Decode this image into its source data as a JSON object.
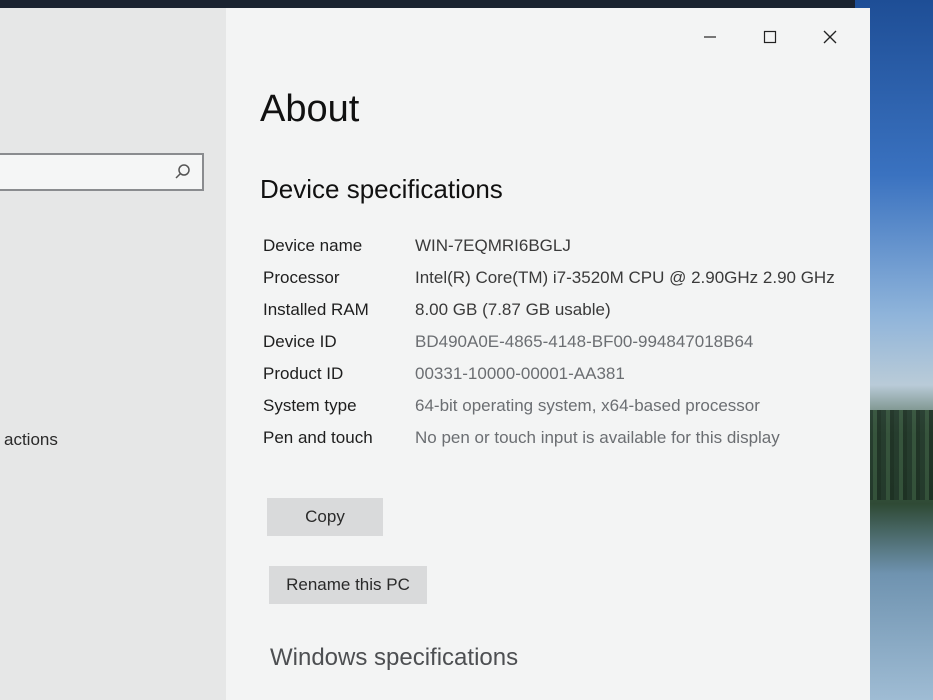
{
  "window": {
    "title": "About",
    "controls": {
      "minimize": "—",
      "maximize": "☐",
      "close": "✕"
    }
  },
  "sidebar": {
    "search": {
      "value": "",
      "placeholder": ""
    },
    "items": [
      {
        "label": "actions"
      }
    ]
  },
  "device_specs": {
    "title": "Device specifications",
    "rows": [
      {
        "label": "Device name",
        "value": "WIN-7EQMRI6BGLJ"
      },
      {
        "label": "Processor",
        "value": "Intel(R) Core(TM) i7-3520M CPU @ 2.90GHz   2.90 GHz"
      },
      {
        "label": "Installed RAM",
        "value": "8.00 GB (7.87 GB usable)"
      },
      {
        "label": "Device ID",
        "value": "BD490A0E-4865-4148-BF00-994847018B64"
      },
      {
        "label": "Product ID",
        "value": "00331-10000-00001-AA381"
      },
      {
        "label": "System type",
        "value": "64-bit operating system, x64-based processor"
      },
      {
        "label": "Pen and touch",
        "value": "No pen or touch input is available for this display"
      }
    ],
    "copy_label": "Copy",
    "rename_label": "Rename this PC"
  },
  "windows_specs": {
    "title": "Windows specifications"
  }
}
